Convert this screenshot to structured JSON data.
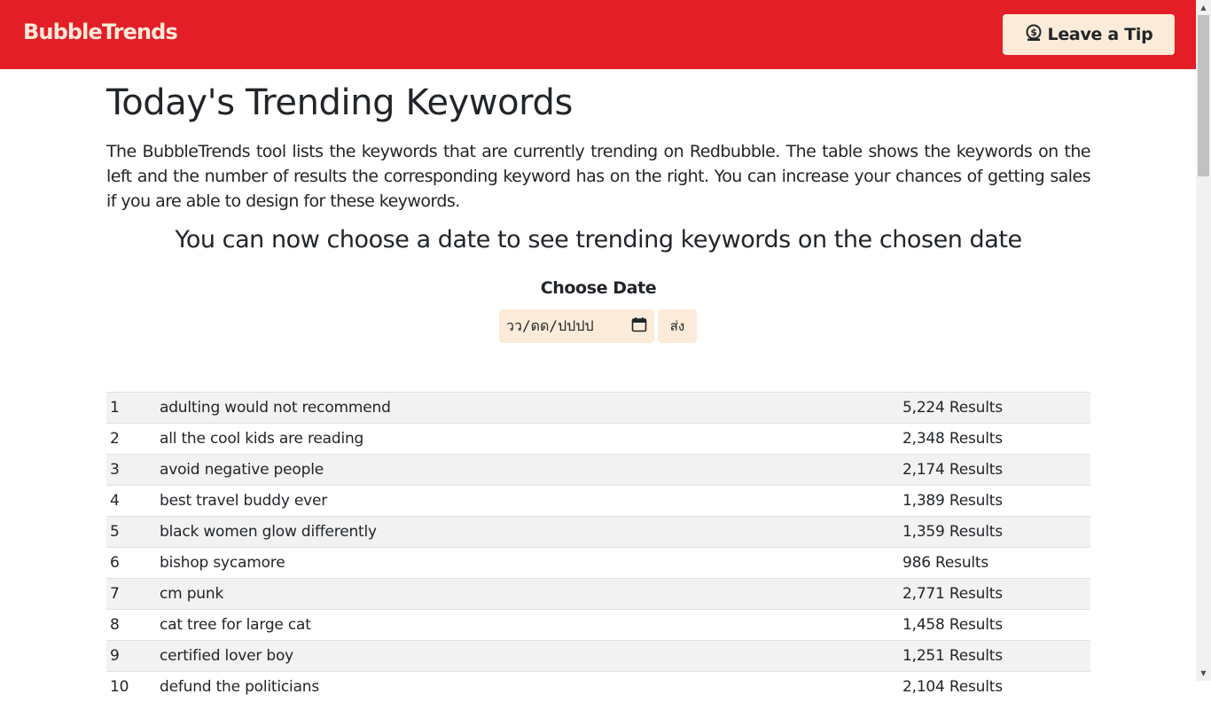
{
  "brand": "BubbleTrends",
  "tip_button": "Leave a Tip",
  "page_title": "Today's Trending Keywords",
  "intro": "The BubbleTrends tool lists the keywords that are currently trending on Redbubble. The table shows the keywords on the left and the number of results the corresponding keyword has on the right. You can increase your chances of getting sales if you are able to design for these keywords.",
  "subtitle": "You can now choose a date to see trending keywords on the chosen date",
  "date_label": "Choose Date",
  "date_input_placeholder": "วว/ดด/ปปปป",
  "submit_label": "ส่ง",
  "keywords": [
    {
      "rank": "1",
      "keyword": "adulting would not recommend",
      "results": "5,224 Results"
    },
    {
      "rank": "2",
      "keyword": "all the cool kids are reading",
      "results": "2,348 Results"
    },
    {
      "rank": "3",
      "keyword": "avoid negative people",
      "results": "2,174 Results"
    },
    {
      "rank": "4",
      "keyword": "best travel buddy ever",
      "results": "1,389 Results"
    },
    {
      "rank": "5",
      "keyword": "black women glow differently",
      "results": "1,359 Results"
    },
    {
      "rank": "6",
      "keyword": "bishop sycamore",
      "results": "986 Results"
    },
    {
      "rank": "7",
      "keyword": "cm punk",
      "results": "2,771 Results"
    },
    {
      "rank": "8",
      "keyword": "cat tree for large cat",
      "results": "1,458 Results"
    },
    {
      "rank": "9",
      "keyword": "certified lover boy",
      "results": "1,251 Results"
    },
    {
      "rank": "10",
      "keyword": "defund the politicians",
      "results": "2,104 Results"
    }
  ],
  "colors": {
    "navbar": "#e31e26",
    "brand": "#fde9da",
    "button_bg": "#fcebd8",
    "stripe": "#f2f2f2"
  },
  "icons": {
    "tip": "dollar-coin-icon",
    "calendar": "calendar-icon"
  }
}
